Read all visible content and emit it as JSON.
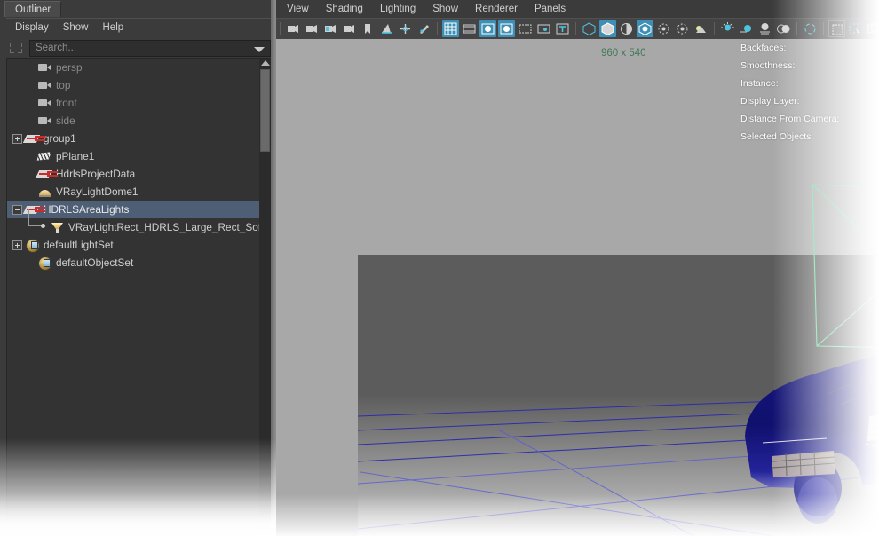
{
  "outliner": {
    "tab_label": "Outliner",
    "menus": [
      "Display",
      "Show",
      "Help"
    ],
    "select_icon": "marquee-select-icon",
    "search": {
      "placeholder": "Search...",
      "value": ""
    },
    "tree": [
      {
        "label": "persp",
        "icon": "camera-icon",
        "depth": 1,
        "expander": "none",
        "dim": true,
        "selected": false
      },
      {
        "label": "top",
        "icon": "camera-icon",
        "depth": 1,
        "expander": "none",
        "dim": true,
        "selected": false
      },
      {
        "label": "front",
        "icon": "camera-icon",
        "depth": 1,
        "expander": "none",
        "dim": true,
        "selected": false
      },
      {
        "label": "side",
        "icon": "camera-icon",
        "depth": 1,
        "expander": "none",
        "dim": true,
        "selected": false
      },
      {
        "label": "group1",
        "icon": "transform-icon",
        "depth": 0,
        "expander": "plus",
        "dim": false,
        "selected": false
      },
      {
        "label": "pPlane1",
        "icon": "mesh-icon",
        "depth": 1,
        "expander": "none",
        "dim": false,
        "selected": false
      },
      {
        "label": "HdrlsProjectData",
        "icon": "transform-icon",
        "depth": 1,
        "expander": "none",
        "dim": false,
        "selected": false
      },
      {
        "label": "VRayLightDome1",
        "icon": "dome-light-icon",
        "depth": 1,
        "expander": "none",
        "dim": false,
        "selected": false
      },
      {
        "label": "HDRLSAreaLights",
        "icon": "transform-icon",
        "depth": 0,
        "expander": "minus",
        "dim": false,
        "selected": true
      },
      {
        "label": "VRayLightRect_HDRLS_Large_Rect_Softbox_",
        "icon": "area-light-icon",
        "depth": 2,
        "expander": "none",
        "dim": false,
        "selected": false
      },
      {
        "label": "defaultLightSet",
        "icon": "set-icon",
        "depth": 0,
        "expander": "plus",
        "dim": false,
        "selected": false
      },
      {
        "label": "defaultObjectSet",
        "icon": "set-icon",
        "depth": 1,
        "expander": "none",
        "dim": false,
        "selected": false
      }
    ]
  },
  "viewport": {
    "menus": [
      "View",
      "Shading",
      "Lighting",
      "Show",
      "Renderer",
      "Panels"
    ],
    "toolbar": [
      {
        "name": "select-camera-icon",
        "active": false,
        "sep_after": false
      },
      {
        "name": "camera-icon",
        "active": false,
        "sep_after": false
      },
      {
        "name": "lock-camera-icon",
        "active": false,
        "sep_after": false
      },
      {
        "name": "camera-attributes-icon",
        "active": false,
        "sep_after": false
      },
      {
        "name": "bookmark-icon",
        "active": false,
        "sep_after": false
      },
      {
        "name": "image-plane-icon",
        "active": false,
        "sep_after": false
      },
      {
        "name": "two-d-pan-zoom-icon",
        "active": false,
        "sep_after": false
      },
      {
        "name": "grease-pencil-icon",
        "active": false,
        "sep_after": true
      },
      {
        "name": "grid-icon",
        "active": true,
        "sep_after": false
      },
      {
        "name": "film-gate-icon",
        "active": false,
        "sep_after": false
      },
      {
        "name": "resolution-gate-icon",
        "active": true,
        "sep_after": false
      },
      {
        "name": "gate-mask-icon",
        "active": true,
        "sep_after": false
      },
      {
        "name": "field-chart-icon",
        "active": false,
        "sep_after": false
      },
      {
        "name": "safe-action-icon",
        "active": false,
        "sep_after": false
      },
      {
        "name": "safe-title-icon",
        "active": false,
        "sep_after": true
      },
      {
        "name": "wireframe-icon",
        "active": false,
        "sep_after": false
      },
      {
        "name": "smooth-shade-icon",
        "active": true,
        "sep_after": false
      },
      {
        "name": "shade-flat-icon",
        "active": false,
        "sep_after": false
      },
      {
        "name": "wireframe-on-shaded-icon",
        "active": true,
        "sep_after": false
      },
      {
        "name": "xray-icon",
        "active": false,
        "sep_after": false
      },
      {
        "name": "xray-joints-icon",
        "active": false,
        "sep_after": false
      },
      {
        "name": "texture-icon",
        "active": false,
        "sep_after": true
      },
      {
        "name": "use-default-lighting-icon",
        "active": false,
        "sep_after": false
      },
      {
        "name": "use-all-lights-icon",
        "active": false,
        "sep_after": false
      },
      {
        "name": "shadows-icon",
        "active": false,
        "sep_after": false
      },
      {
        "name": "screen-space-ao-icon",
        "active": false,
        "sep_after": true
      },
      {
        "name": "isolate-select-icon",
        "active": false,
        "sep_after": true
      },
      {
        "name": "paint-effects-icon",
        "active": false,
        "sep_after": false
      },
      {
        "name": "xray-active-icon",
        "active": false,
        "sep_after": false
      },
      {
        "name": "exposure-icon",
        "active": false,
        "sep_after": true
      },
      {
        "name": "view-settings-icon",
        "active": false,
        "sep_after": false
      }
    ],
    "resolution_label": "960 x 540",
    "hud": [
      "Backfaces:",
      "Smoothness:",
      "Instance:",
      "Display Layer:",
      "Distance From Camera:",
      "Selected Objects:"
    ]
  },
  "colors": {
    "panel_bg": "#3b3b3b",
    "tree_bg": "#333333",
    "selection": "#4e5e74",
    "accent_blue": "#3d8fb5",
    "viewport_sky": "#a8a8a8",
    "viewport_ground": "#5c5c5c",
    "light_gizmo": "#66e0a0",
    "mesh_blue": "#10107a",
    "res_text": "#3f7a58",
    "grid_line": "#2a2ab0"
  }
}
